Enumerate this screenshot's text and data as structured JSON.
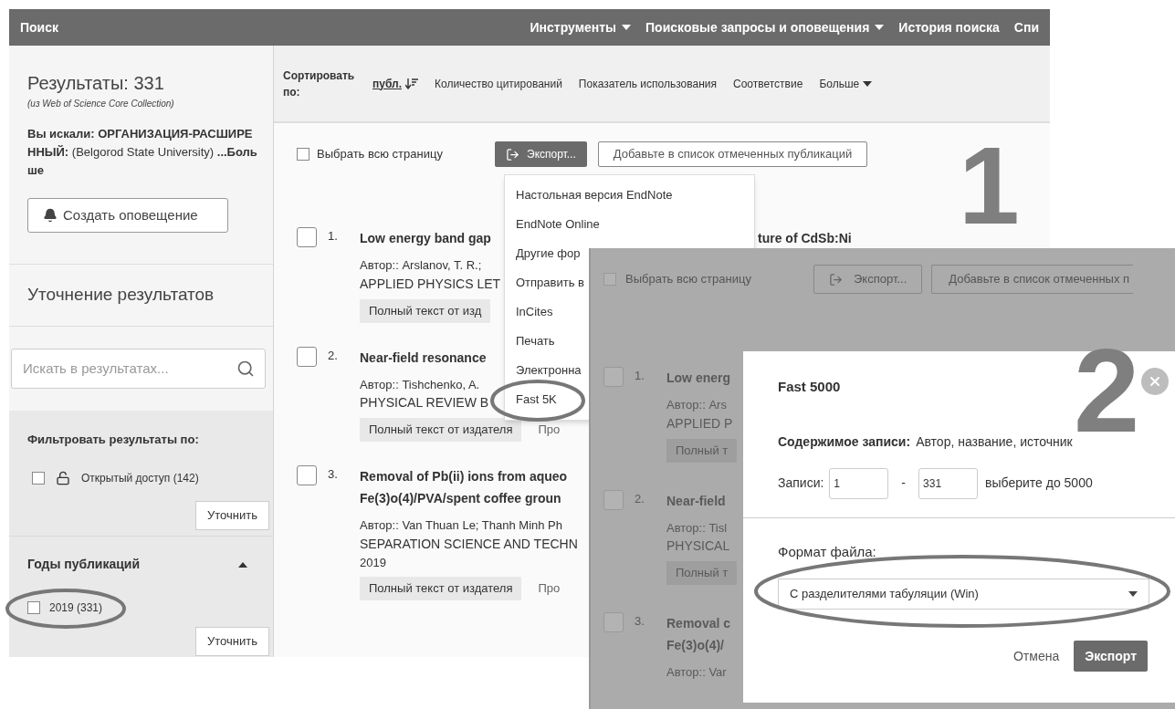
{
  "screenshot_1": {
    "nav": {
      "title": "Поиск",
      "items": [
        {
          "label": "Инструменты",
          "dropdown": true
        },
        {
          "label": "Поисковые запросы и оповещения",
          "dropdown": true
        },
        {
          "label": "История поиска",
          "dropdown": false
        },
        {
          "label": "Спи",
          "dropdown": false
        }
      ]
    },
    "sidebar": {
      "results_title": "Результаты: 331",
      "results_source": "(из Web of Science Core Collection)",
      "query": "**Вы искали: ОРГАНИЗАЦИЯ-РАСШИРЕННЫЙ:** (Belgorod State University) **...Больше**",
      "alert_button": "Создать оповещение",
      "refine_title": "Уточнение результатов",
      "search": {
        "placeholder": "Искать в результатах..."
      },
      "filter_title": "Фильтровать результаты по:",
      "open_access": {
        "label": "Открытый доступ (142)",
        "checked": false
      },
      "refine_button": "Уточнить",
      "years": {
        "title": "Годы публикаций",
        "expanded": true,
        "items": [
          {
            "label": "2019 (331)",
            "checked": false
          }
        ],
        "refine_button": "Уточнить"
      }
    },
    "sort": {
      "label": "Сортировать по:",
      "options": [
        {
          "label": "публ.",
          "selected": true
        },
        {
          "label": "Количество цитирований",
          "selected": false
        },
        {
          "label": "Показатель использования",
          "selected": false
        },
        {
          "label": "Соответствие",
          "selected": false
        }
      ],
      "more": "Больше"
    },
    "toolbar": {
      "select_page": {
        "label": "Выбрать всю страницу",
        "checked": false
      },
      "export_button": "Экспорт...",
      "add_button": "Добавьте в список отмеченных публикаций"
    },
    "export_menu": {
      "items": [
        "Настольная версия EndNote",
        "EndNote Online",
        "Другие фор",
        "Отправить в",
        "InCites",
        "Печать",
        "Электронна",
        "Fast 5K"
      ]
    },
    "results": [
      {
        "number": "1.",
        "checked": false,
        "title": [
          "Low energy band gap"
        ],
        "title_tail": "ture of CdSb:Ni",
        "authors": "Автор:: Arslanov, T. R.;",
        "source": "APPLIED PHYSICS LET",
        "buttons": [
          "Полный текст от изд"
        ]
      },
      {
        "number": "2.",
        "checked": false,
        "title": [
          "Near-field resonance"
        ],
        "authors": "Автор:: Tishchenko, A.",
        "source": "PHYSICAL REVIEW B",
        "buttons": [
          "Полный текст от издателя"
        ],
        "link": "Про"
      },
      {
        "number": "3.",
        "checked": false,
        "title": [
          "Removal of Pb(ii) ions from aqueo",
          "Fe(3)o(4)/PVA/spent coffee groun"
        ],
        "authors": "Автор:: Van Thuan Le; Thanh Minh Ph",
        "source": "SEPARATION SCIENCE AND TECHN",
        "year": "2019",
        "buttons": [
          "Полный текст от издателя"
        ],
        "link": "Про"
      }
    ],
    "step_number": "1"
  },
  "screenshot_2": {
    "toolbar": {
      "select_page": {
        "label": "Выбрать всю страницу",
        "checked": false
      },
      "export_button": "Экспорт...",
      "add_button": "Добавьте в список отмеченных п"
    },
    "results": [
      {
        "number": "1.",
        "checked": false,
        "title": [
          "Low energ"
        ],
        "authors": "Автор:: Ars",
        "source": "APPLIED P",
        "buttons": [
          "Полный т"
        ]
      },
      {
        "number": "2.",
        "checked": false,
        "title": [
          "Near-field"
        ],
        "authors": "Автор:: Tisl",
        "source": "PHYSICAL",
        "buttons": [
          "Полный т"
        ]
      },
      {
        "number": "3.",
        "checked": false,
        "title": [
          "Removal c",
          "Fe(3)o(4)/"
        ],
        "authors": "Автор:: Var"
      }
    ],
    "dialog": {
      "title": "Fast 5000",
      "step_number": "2",
      "content_label": "Содержимое записи:",
      "content_value": "Автор, название, источник",
      "records_label": "Записи:",
      "records_from": "1",
      "records_dash": "-",
      "records_to": "331",
      "records_hint": "выберите до 5000",
      "format_label": "Формат файла:",
      "format_value": "С разделителями табуляции (Win)",
      "cancel": "Отмена",
      "export": "Экспорт"
    }
  }
}
